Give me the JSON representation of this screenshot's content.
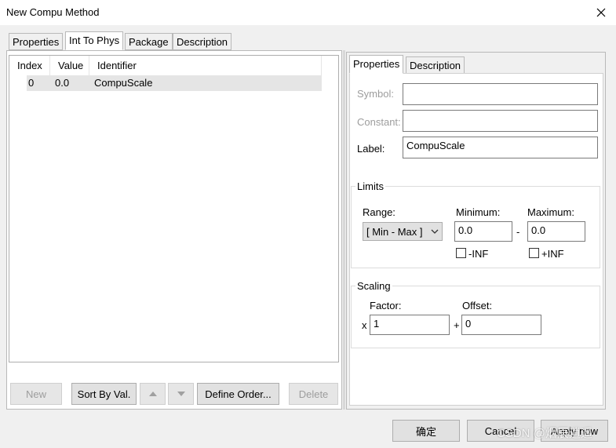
{
  "window": {
    "title": "New Compu Method"
  },
  "left_tabs": [
    {
      "label": "Properties"
    },
    {
      "label": "Int To Phys"
    },
    {
      "label": "Package"
    },
    {
      "label": "Description"
    }
  ],
  "table": {
    "columns": [
      "Index",
      "Value",
      "Identifier"
    ],
    "rows": [
      {
        "index": "0",
        "value": "0.0",
        "identifier": "CompuScale"
      }
    ]
  },
  "left_buttons": {
    "new": "New",
    "sort": "Sort By Val.",
    "define_order": "Define Order...",
    "delete": "Delete"
  },
  "right_tabs": [
    {
      "label": "Properties"
    },
    {
      "label": "Description"
    }
  ],
  "properties": {
    "symbol_label": "Symbol:",
    "symbol_value": "",
    "constant_label": "Constant:",
    "constant_value": "",
    "label_label": "Label:",
    "label_value": "CompuScale"
  },
  "limits": {
    "title": "Limits",
    "range_label": "Range:",
    "range_value": "[ Min - Max ]",
    "minimum_label": "Minimum:",
    "minimum_value": "0.0",
    "dash": "-",
    "maximum_label": "Maximum:",
    "maximum_value": "0.0",
    "minus_inf_label": "-INF",
    "plus_inf_label": "+INF"
  },
  "scaling": {
    "title": "Scaling",
    "factor_label": "Factor:",
    "factor_value": "1",
    "multiply_symbol": "x",
    "plus_symbol": "+",
    "offset_label": "Offset:",
    "offset_value": "0"
  },
  "bottom_buttons": {
    "ok": "确定",
    "cancel": "Cancel",
    "apply": "Apply now"
  },
  "watermark": "CSDN @烟辰逍遥",
  "colors": {
    "window_bg": "#f0f0f0",
    "panel_bg": "#ffffff",
    "selected_row": "#e5e5e5",
    "disabled_text": "#9d9d9d"
  }
}
